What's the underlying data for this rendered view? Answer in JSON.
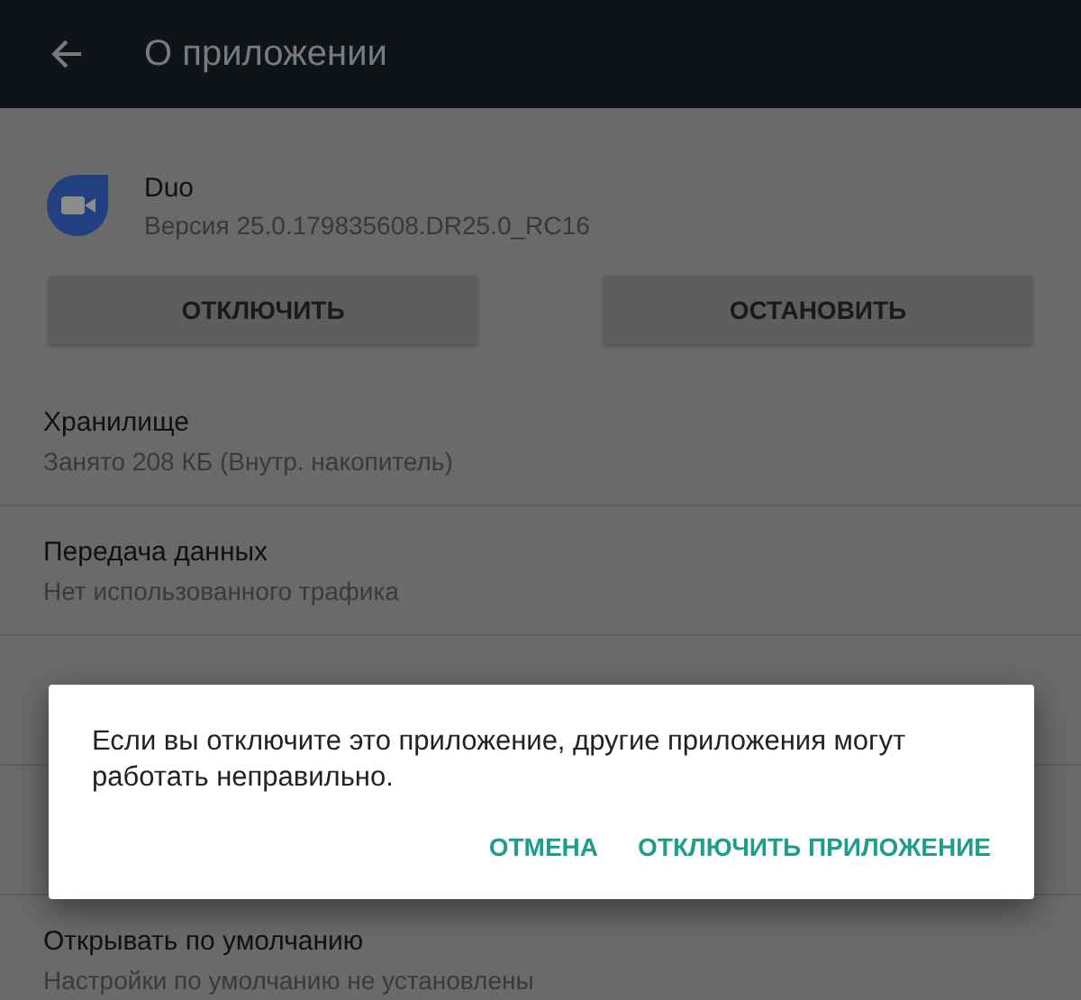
{
  "app_bar": {
    "title": "О приложении"
  },
  "app": {
    "name": "Duo",
    "version": "Версия 25.0.179835608.DR25.0_RC16"
  },
  "actions": [
    "ОТКЛЮЧИТЬ",
    "ОСТАНОВИТЬ"
  ],
  "settings": [
    {
      "title": "Хранилище",
      "subtitle": "Занято 208 КБ (Внутр. накопитель)"
    },
    {
      "title": "Передача данных",
      "subtitle": "Нет использованного трафика"
    },
    {
      "hidden": true
    },
    {
      "hidden": true
    },
    {
      "title": "Открывать по умолчанию",
      "subtitle": "Настройки по умолчанию не установлены"
    }
  ],
  "dialog": {
    "message": "Если вы отключите это приложение, другие приложения могут работать неправильно.",
    "buttons": [
      "ОТМЕНА",
      "ОТКЛЮЧИТЬ ПРИЛОЖЕНИЕ"
    ]
  }
}
